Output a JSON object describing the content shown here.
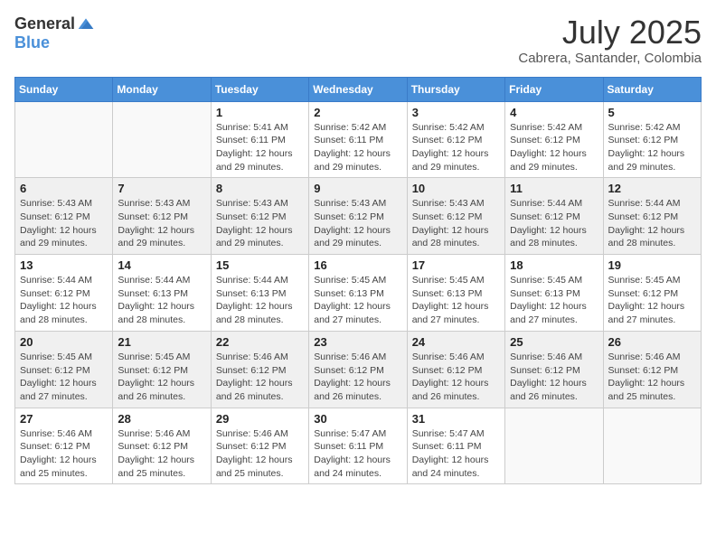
{
  "header": {
    "logo_general": "General",
    "logo_blue": "Blue",
    "month_year": "July 2025",
    "location": "Cabrera, Santander, Colombia"
  },
  "days_of_week": [
    "Sunday",
    "Monday",
    "Tuesday",
    "Wednesday",
    "Thursday",
    "Friday",
    "Saturday"
  ],
  "weeks": [
    [
      {
        "day": "",
        "sunrise": "",
        "sunset": "",
        "daylight": "",
        "empty": true
      },
      {
        "day": "",
        "sunrise": "",
        "sunset": "",
        "daylight": "",
        "empty": true
      },
      {
        "day": "1",
        "sunrise": "Sunrise: 5:41 AM",
        "sunset": "Sunset: 6:11 PM",
        "daylight": "Daylight: 12 hours and 29 minutes.",
        "empty": false
      },
      {
        "day": "2",
        "sunrise": "Sunrise: 5:42 AM",
        "sunset": "Sunset: 6:11 PM",
        "daylight": "Daylight: 12 hours and 29 minutes.",
        "empty": false
      },
      {
        "day": "3",
        "sunrise": "Sunrise: 5:42 AM",
        "sunset": "Sunset: 6:12 PM",
        "daylight": "Daylight: 12 hours and 29 minutes.",
        "empty": false
      },
      {
        "day": "4",
        "sunrise": "Sunrise: 5:42 AM",
        "sunset": "Sunset: 6:12 PM",
        "daylight": "Daylight: 12 hours and 29 minutes.",
        "empty": false
      },
      {
        "day": "5",
        "sunrise": "Sunrise: 5:42 AM",
        "sunset": "Sunset: 6:12 PM",
        "daylight": "Daylight: 12 hours and 29 minutes.",
        "empty": false
      }
    ],
    [
      {
        "day": "6",
        "sunrise": "Sunrise: 5:43 AM",
        "sunset": "Sunset: 6:12 PM",
        "daylight": "Daylight: 12 hours and 29 minutes.",
        "empty": false
      },
      {
        "day": "7",
        "sunrise": "Sunrise: 5:43 AM",
        "sunset": "Sunset: 6:12 PM",
        "daylight": "Daylight: 12 hours and 29 minutes.",
        "empty": false
      },
      {
        "day": "8",
        "sunrise": "Sunrise: 5:43 AM",
        "sunset": "Sunset: 6:12 PM",
        "daylight": "Daylight: 12 hours and 29 minutes.",
        "empty": false
      },
      {
        "day": "9",
        "sunrise": "Sunrise: 5:43 AM",
        "sunset": "Sunset: 6:12 PM",
        "daylight": "Daylight: 12 hours and 29 minutes.",
        "empty": false
      },
      {
        "day": "10",
        "sunrise": "Sunrise: 5:43 AM",
        "sunset": "Sunset: 6:12 PM",
        "daylight": "Daylight: 12 hours and 28 minutes.",
        "empty": false
      },
      {
        "day": "11",
        "sunrise": "Sunrise: 5:44 AM",
        "sunset": "Sunset: 6:12 PM",
        "daylight": "Daylight: 12 hours and 28 minutes.",
        "empty": false
      },
      {
        "day": "12",
        "sunrise": "Sunrise: 5:44 AM",
        "sunset": "Sunset: 6:12 PM",
        "daylight": "Daylight: 12 hours and 28 minutes.",
        "empty": false
      }
    ],
    [
      {
        "day": "13",
        "sunrise": "Sunrise: 5:44 AM",
        "sunset": "Sunset: 6:12 PM",
        "daylight": "Daylight: 12 hours and 28 minutes.",
        "empty": false
      },
      {
        "day": "14",
        "sunrise": "Sunrise: 5:44 AM",
        "sunset": "Sunset: 6:13 PM",
        "daylight": "Daylight: 12 hours and 28 minutes.",
        "empty": false
      },
      {
        "day": "15",
        "sunrise": "Sunrise: 5:44 AM",
        "sunset": "Sunset: 6:13 PM",
        "daylight": "Daylight: 12 hours and 28 minutes.",
        "empty": false
      },
      {
        "day": "16",
        "sunrise": "Sunrise: 5:45 AM",
        "sunset": "Sunset: 6:13 PM",
        "daylight": "Daylight: 12 hours and 27 minutes.",
        "empty": false
      },
      {
        "day": "17",
        "sunrise": "Sunrise: 5:45 AM",
        "sunset": "Sunset: 6:13 PM",
        "daylight": "Daylight: 12 hours and 27 minutes.",
        "empty": false
      },
      {
        "day": "18",
        "sunrise": "Sunrise: 5:45 AM",
        "sunset": "Sunset: 6:13 PM",
        "daylight": "Daylight: 12 hours and 27 minutes.",
        "empty": false
      },
      {
        "day": "19",
        "sunrise": "Sunrise: 5:45 AM",
        "sunset": "Sunset: 6:12 PM",
        "daylight": "Daylight: 12 hours and 27 minutes.",
        "empty": false
      }
    ],
    [
      {
        "day": "20",
        "sunrise": "Sunrise: 5:45 AM",
        "sunset": "Sunset: 6:12 PM",
        "daylight": "Daylight: 12 hours and 27 minutes.",
        "empty": false
      },
      {
        "day": "21",
        "sunrise": "Sunrise: 5:45 AM",
        "sunset": "Sunset: 6:12 PM",
        "daylight": "Daylight: 12 hours and 26 minutes.",
        "empty": false
      },
      {
        "day": "22",
        "sunrise": "Sunrise: 5:46 AM",
        "sunset": "Sunset: 6:12 PM",
        "daylight": "Daylight: 12 hours and 26 minutes.",
        "empty": false
      },
      {
        "day": "23",
        "sunrise": "Sunrise: 5:46 AM",
        "sunset": "Sunset: 6:12 PM",
        "daylight": "Daylight: 12 hours and 26 minutes.",
        "empty": false
      },
      {
        "day": "24",
        "sunrise": "Sunrise: 5:46 AM",
        "sunset": "Sunset: 6:12 PM",
        "daylight": "Daylight: 12 hours and 26 minutes.",
        "empty": false
      },
      {
        "day": "25",
        "sunrise": "Sunrise: 5:46 AM",
        "sunset": "Sunset: 6:12 PM",
        "daylight": "Daylight: 12 hours and 26 minutes.",
        "empty": false
      },
      {
        "day": "26",
        "sunrise": "Sunrise: 5:46 AM",
        "sunset": "Sunset: 6:12 PM",
        "daylight": "Daylight: 12 hours and 25 minutes.",
        "empty": false
      }
    ],
    [
      {
        "day": "27",
        "sunrise": "Sunrise: 5:46 AM",
        "sunset": "Sunset: 6:12 PM",
        "daylight": "Daylight: 12 hours and 25 minutes.",
        "empty": false
      },
      {
        "day": "28",
        "sunrise": "Sunrise: 5:46 AM",
        "sunset": "Sunset: 6:12 PM",
        "daylight": "Daylight: 12 hours and 25 minutes.",
        "empty": false
      },
      {
        "day": "29",
        "sunrise": "Sunrise: 5:46 AM",
        "sunset": "Sunset: 6:12 PM",
        "daylight": "Daylight: 12 hours and 25 minutes.",
        "empty": false
      },
      {
        "day": "30",
        "sunrise": "Sunrise: 5:47 AM",
        "sunset": "Sunset: 6:11 PM",
        "daylight": "Daylight: 12 hours and 24 minutes.",
        "empty": false
      },
      {
        "day": "31",
        "sunrise": "Sunrise: 5:47 AM",
        "sunset": "Sunset: 6:11 PM",
        "daylight": "Daylight: 12 hours and 24 minutes.",
        "empty": false
      },
      {
        "day": "",
        "sunrise": "",
        "sunset": "",
        "daylight": "",
        "empty": true
      },
      {
        "day": "",
        "sunrise": "",
        "sunset": "",
        "daylight": "",
        "empty": true
      }
    ]
  ],
  "shaded_rows": [
    1,
    3
  ]
}
